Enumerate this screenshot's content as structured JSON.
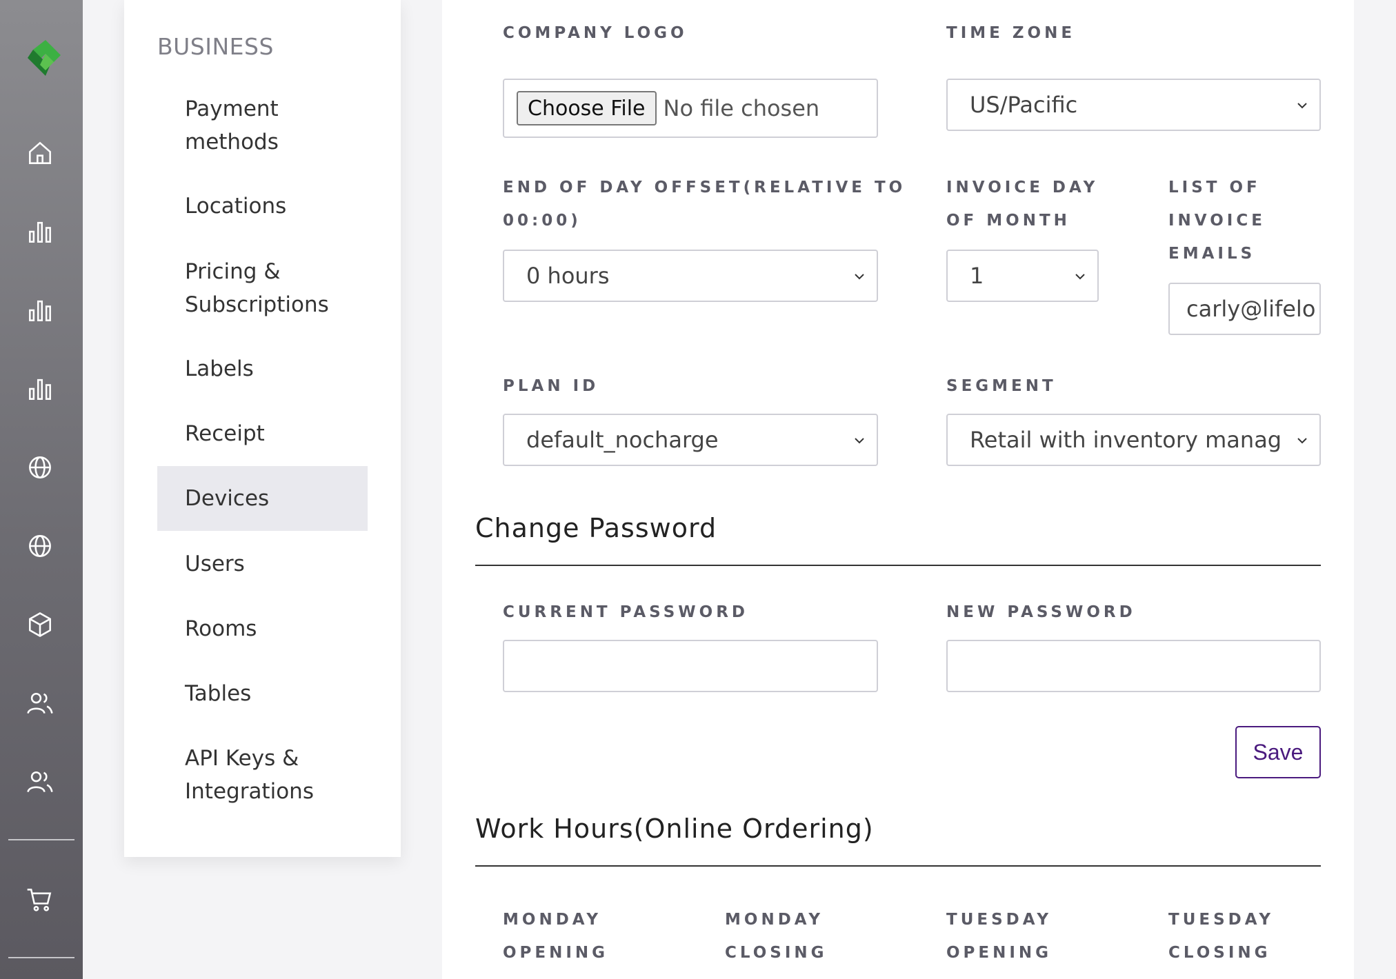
{
  "sidebar": {
    "heading": "BUSINESS",
    "items": [
      {
        "label": "Payment methods",
        "line1": "Payment",
        "line2": "methods"
      },
      {
        "label": "Locations"
      },
      {
        "label": "Pricing & Subscriptions",
        "line1": "Pricing &",
        "line2": "Subscriptions"
      },
      {
        "label": "Labels"
      },
      {
        "label": "Receipt"
      },
      {
        "label": "Devices",
        "active": true
      },
      {
        "label": "Users"
      },
      {
        "label": "Rooms"
      },
      {
        "label": "Tables"
      },
      {
        "label": "API Keys & Integrations",
        "line1": "API Keys &",
        "line2": "Integrations"
      }
    ]
  },
  "rail": {
    "icons": [
      "logo-icon",
      "home-icon",
      "bar-chart-icon",
      "bar-chart-icon",
      "bar-chart-icon",
      "globe-icon",
      "globe-icon",
      "box-icon",
      "users-icon",
      "users-icon",
      "cart-icon"
    ],
    "brand_color": "#2ea043"
  },
  "form": {
    "company_logo": {
      "label": "COMPANY LOGO",
      "button": "Choose File",
      "status": "No file chosen"
    },
    "time_zone": {
      "label": "TIME ZONE",
      "value": "US/Pacific"
    },
    "end_of_day": {
      "label_line1": "END OF DAY OFFSET(RELATIVE TO",
      "label_line2": "00:00)",
      "value": "0 hours"
    },
    "invoice_day": {
      "label_line1": "INVOICE DAY",
      "label_line2": "OF MONTH",
      "value": "1"
    },
    "invoice_emails": {
      "label_line1": "LIST OF",
      "label_line2": "INVOICE",
      "label_line3": "EMAILS",
      "value": "carly@lifelo"
    },
    "plan_id": {
      "label": "PLAN ID",
      "value": "default_nocharge"
    },
    "segment": {
      "label": "SEGMENT",
      "value": "Retail with inventory managem"
    }
  },
  "password": {
    "title": "Change Password",
    "current_label": "CURRENT PASSWORD",
    "new_label": "NEW PASSWORD",
    "save_label": "Save",
    "save_color": "#4a1a7e"
  },
  "work_hours": {
    "title": "Work Hours(Online Ordering)",
    "columns": [
      {
        "line1": "MONDAY",
        "line2": "OPENING"
      },
      {
        "line1": "MONDAY",
        "line2": "CLOSING"
      },
      {
        "line1": "TUESDAY",
        "line2": "OPENING"
      },
      {
        "line1": "TUESDAY",
        "line2": "CLOSING"
      }
    ]
  }
}
